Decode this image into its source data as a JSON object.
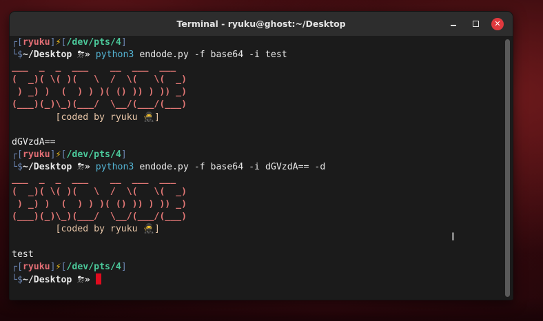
{
  "window": {
    "title": "Terminal - ryuku@ghost:~/Desktop",
    "close_glyph": "✕"
  },
  "terminal": {
    "prompt": {
      "top_corner": "┌",
      "bottom_corner": "└",
      "user": "ryuku",
      "bolt": "⚡",
      "tty": "/dev/pts/4",
      "dollar": "$",
      "cwd": "~/Desktop",
      "weather": "⛈",
      "arrow": "»"
    },
    "blocks": [
      {
        "command": "python3",
        "args": "endode.py -f base64 -i test",
        "banner": [
          "___  _  _  ___    __  ___  ___",
          "(  _)( \\( )(   \\  /  \\(   \\(  _)",
          " ) _) )  (  ) ) )( () )) ) )) _)",
          "(___)(_)\\_)(___/  \\__/(___/(___)"
        ],
        "coded_by": "[coded by ryuku 🥷]",
        "output": "dGVzdA=="
      },
      {
        "command": "python3",
        "args": "endode.py -f base64 -i dGVzdA== -d",
        "banner": [
          "___  _  _  ___    __  ___  ___",
          "(  _)( \\( )(   \\  /  \\(   \\(  _)",
          " ) _) )  (  ) ) )( () )) ) )) _)",
          "(___)(_)\\_)(___/  \\__/(___/(___)"
        ],
        "coded_by": "[coded by ryuku 🥷]",
        "output": "test"
      }
    ]
  }
}
